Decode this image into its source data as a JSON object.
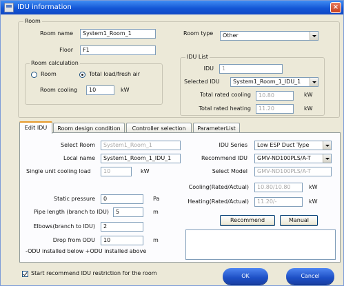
{
  "window": {
    "title": "IDU information",
    "close": "×"
  },
  "room": {
    "legend": "Room",
    "name_label": "Room name",
    "name_value": "System1_Room_1",
    "floor_label": "Floor",
    "floor_value": "F1",
    "type_label": "Room type",
    "type_value": "Other"
  },
  "calc": {
    "legend": "Room calculation",
    "opt_room": "Room",
    "opt_total": "Total load/fresh air",
    "selected": "total",
    "cooling_label": "Room cooling",
    "cooling_value": "10",
    "cooling_unit": "kW"
  },
  "idu_list": {
    "legend": "IDU List",
    "idu_label": "IDU",
    "idu_value": "1",
    "selected_label": "Selected IDU",
    "selected_value": "System1_Room_1_IDU_1",
    "rated_cooling_label": "Total rated cooling",
    "rated_cooling_value": "10.80",
    "rated_cooling_unit": "kW",
    "rated_heating_label": "Total rated heating",
    "rated_heating_value": "11.20",
    "rated_heating_unit": "kW"
  },
  "tabs": [
    {
      "label": "Edit IDU",
      "active": true
    },
    {
      "label": "Room design condition",
      "active": false
    },
    {
      "label": "Controller selection",
      "active": false
    },
    {
      "label": "ParameterList",
      "active": false
    }
  ],
  "edit": {
    "select_room_label": "Select Room",
    "select_room_value": "System1_Room_1",
    "local_name_label": "Local name",
    "local_name_value": "System1_Room_1_IDU_1",
    "single_load_label": "Single unit cooling load",
    "single_load_value": "10",
    "single_load_unit": "kW",
    "static_label": "Static pressure",
    "static_value": "0",
    "static_unit": "Pa",
    "pipe_label": "Pipe length (branch to IDU)",
    "pipe_value": "5",
    "pipe_unit": "m",
    "elbows_label": "Elbows(branch to IDU)",
    "elbows_value": "2",
    "drop_label": "Drop from ODU",
    "drop_value": "10",
    "drop_unit": "m",
    "drop_note": "-ODU installed below +ODU installed above",
    "series_label": "IDU Series",
    "series_value": "Low ESP Duct Type",
    "recommend_label": "Recommend IDU",
    "recommend_value": "GMV-ND100PLS/A-T",
    "model_label": "Select Model",
    "model_value": "GMV-ND100PLS/A-T",
    "cooling_label": "Cooling(Rated/Actual)",
    "cooling_value": "10.80/10.80",
    "cooling_unit": "kW",
    "heating_label": "Heating(Rated/Actual)",
    "heating_value": "11.20/-",
    "heating_unit": "kW",
    "recommend_button": "Recommend",
    "manual_button": "Manual"
  },
  "footer": {
    "restriction_label": "Start recommend IDU restriction for the room",
    "restriction_checked": true,
    "ok_label": "OK",
    "cancel_label": "Cancel"
  }
}
